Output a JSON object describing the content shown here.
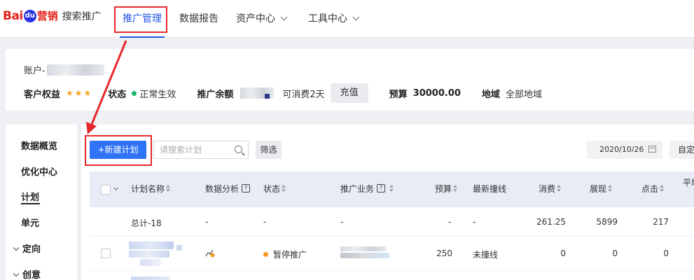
{
  "brand": {
    "bai": "Bai",
    "paw": "du",
    "ying": "营销",
    "product": "搜索推广"
  },
  "nav": {
    "items": [
      {
        "label": "推广管理",
        "active": true
      },
      {
        "label": "数据报告"
      },
      {
        "label": "资产中心",
        "dropdown": true
      },
      {
        "label": "工具中心",
        "dropdown": true
      }
    ]
  },
  "account": {
    "account_label": "账户-",
    "rights_label": "客户权益",
    "stars": "★★★",
    "status_label": "状态",
    "status_value": "正常生效",
    "status_color": "#19b36b",
    "balance_label": "推广余额",
    "balance_days": "可消费2天",
    "recharge_label": "充值",
    "budget_label": "预算",
    "budget_value": "30000.00",
    "region_label": "地域",
    "region_value": "全部地域"
  },
  "sidebar": {
    "items": [
      {
        "label": "数据概览"
      },
      {
        "label": "优化中心"
      },
      {
        "label": "计划",
        "active": true
      },
      {
        "label": "单元"
      },
      {
        "label": "定向",
        "expandable": true
      },
      {
        "label": "创意",
        "expandable": true
      }
    ]
  },
  "toolbar": {
    "new_plan_label": "+新建计划",
    "search_placeholder": "请搜索计划",
    "filter_label": "筛选",
    "date_value": "2020/10/26",
    "custom_label": "自定义"
  },
  "table": {
    "headers": {
      "name": "计划名称",
      "analysis": "数据分析",
      "status": "状态",
      "business": "推广业务",
      "budget": "预算",
      "latest": "最新撞线",
      "cost": "消费",
      "impressions": "展现",
      "clicks": "点击",
      "avg": "平均"
    },
    "total_row": {
      "name": "总计-18",
      "analysis": "-",
      "status": "-",
      "business": "-",
      "budget": "-",
      "latest": "-",
      "cost": "261.25",
      "impressions": "5899",
      "clicks": "217"
    },
    "rows": [
      {
        "status": "暂停推广",
        "status_color": "#f59a23",
        "budget": "250",
        "latest": "未撞线",
        "cost": "0",
        "impressions": "0",
        "clicks": "0"
      }
    ]
  },
  "colors": {
    "primary": "#2f73f6",
    "annotation_red": "#e5292b",
    "nav_active": "#1f55e0"
  }
}
